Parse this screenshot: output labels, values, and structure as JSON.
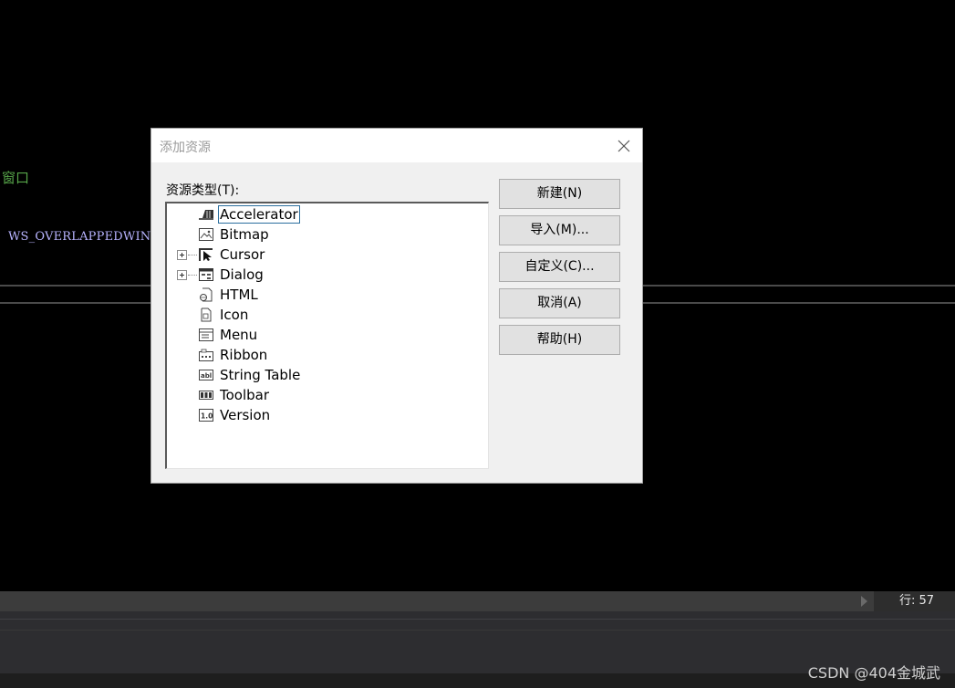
{
  "editor": {
    "comment_text": "窗口",
    "const_text": "WS_OVERLAPPEDWINDO"
  },
  "dialog": {
    "title": "添加资源",
    "list_label": "资源类型(T):",
    "tree_items": [
      {
        "label": "Accelerator",
        "icon": "accelerator-icon",
        "expandable": false,
        "selected": true
      },
      {
        "label": "Bitmap",
        "icon": "bitmap-icon",
        "expandable": false,
        "selected": false
      },
      {
        "label": "Cursor",
        "icon": "cursor-icon",
        "expandable": true,
        "selected": false
      },
      {
        "label": "Dialog",
        "icon": "dialog-icon",
        "expandable": true,
        "selected": false
      },
      {
        "label": "HTML",
        "icon": "html-icon",
        "expandable": false,
        "selected": false
      },
      {
        "label": "Icon",
        "icon": "icon-resource-icon",
        "expandable": false,
        "selected": false
      },
      {
        "label": "Menu",
        "icon": "menu-icon",
        "expandable": false,
        "selected": false
      },
      {
        "label": "Ribbon",
        "icon": "ribbon-icon",
        "expandable": false,
        "selected": false
      },
      {
        "label": "String Table",
        "icon": "string-table-icon",
        "expandable": false,
        "selected": false
      },
      {
        "label": "Toolbar",
        "icon": "toolbar-icon",
        "expandable": false,
        "selected": false
      },
      {
        "label": "Version",
        "icon": "version-icon",
        "expandable": false,
        "selected": false
      }
    ],
    "buttons": {
      "new": "新建(N)",
      "import": "导入(M)...",
      "custom": "自定义(C)...",
      "cancel": "取消(A)",
      "help": "帮助(H)"
    }
  },
  "statusbar": {
    "line": "行: 57"
  },
  "watermark": "CSDN @404金城武",
  "colors": {
    "editor_bg": "#000000",
    "comment": "#57a64a",
    "constant": "#b8b4ff",
    "dialog_bg": "#f0f0f0",
    "button_bg": "#e1e1e1",
    "selection_border": "#2b6f9e",
    "statusbar": "#3c3c3c"
  }
}
